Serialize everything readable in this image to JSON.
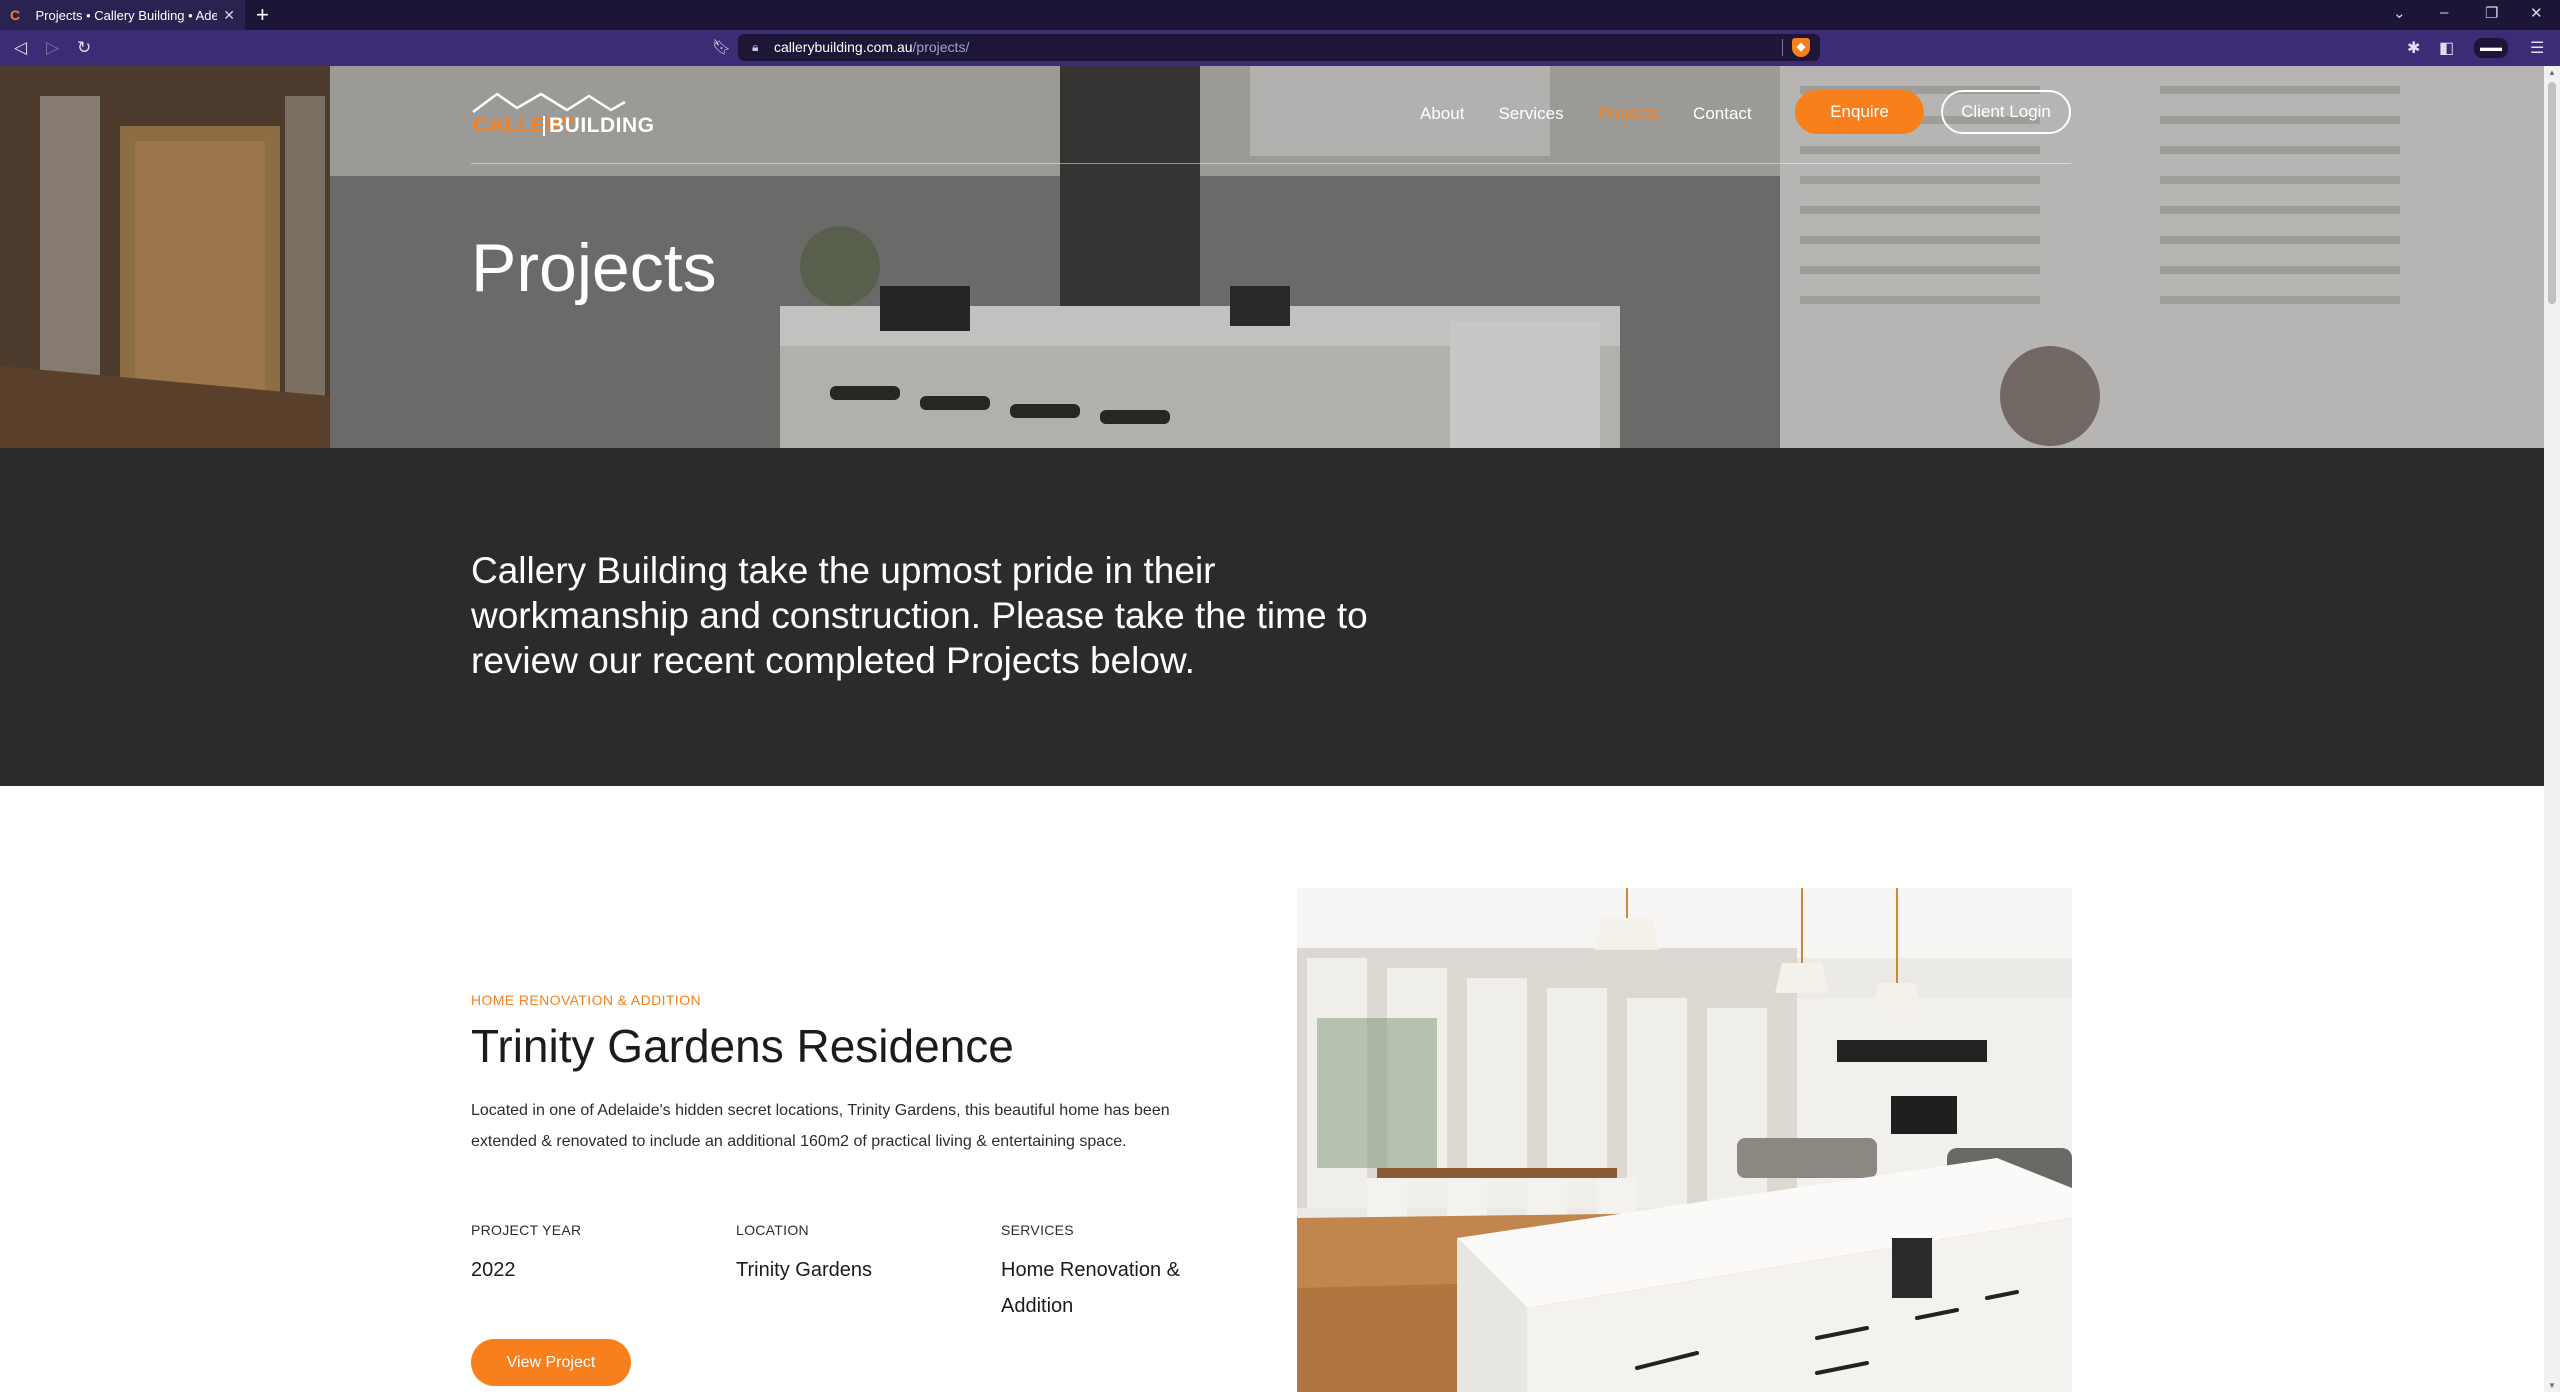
{
  "browser": {
    "tab_title": "Projects • Callery Building • Adela",
    "tab_favicon": "C",
    "url_domain": "callerybuilding.com.au",
    "url_path": "/projects/",
    "icons": [
      "back-icon",
      "forward-icon",
      "reload-icon",
      "bookmark-icon",
      "lock-icon",
      "brave-shield-icon",
      "extensions-icon",
      "sidebar-icon",
      "wallet-icon",
      "menu-icon",
      "minimize-icon",
      "restore-icon",
      "close-icon"
    ]
  },
  "site": {
    "logo_word_a": "CALLERY",
    "logo_word_b": "BUILDING",
    "nav": {
      "about": "About",
      "services": "Services",
      "projects": "Projects",
      "contact": "Contact"
    },
    "enquire": "Enquire",
    "client_login": "Client Login",
    "accent": "#f77f1c",
    "dark_band": "#2b2b2b"
  },
  "hero": {
    "title": "Projects"
  },
  "intro": {
    "text": "Callery Building take the upmost pride in their workmanship and construction. Please take the time to review our recent completed Projects below."
  },
  "project": {
    "category": "HOME RENOVATION & ADDITION",
    "title": "Trinity Gardens Residence",
    "description": "Located in one of Adelaide's hidden secret locations, Trinity Gardens, this beautiful home has been extended & renovated to include an additional 160m2 of practical living & entertaining space.",
    "meta": {
      "year_label": "PROJECT YEAR",
      "year_value": "2022",
      "location_label": "LOCATION",
      "location_value": "Trinity Gardens",
      "services_label": "SERVICES",
      "services_value": "Home Renovation & Addition"
    },
    "cta": "View Project"
  }
}
